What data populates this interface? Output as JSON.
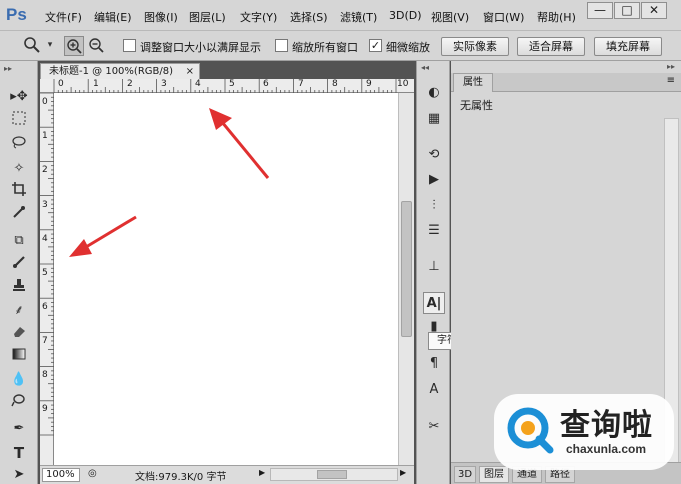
{
  "app": {
    "logo": "Ps",
    "menu": [
      "文件(F)",
      "编辑(E)",
      "图像(I)",
      "图层(L)",
      "文字(Y)",
      "选择(S)",
      "滤镜(T)",
      "3D(D)",
      "视图(V)",
      "窗口(W)",
      "帮助(H)"
    ],
    "window_controls": {
      "minimize": "—",
      "maximize": "□",
      "close": "✕"
    }
  },
  "options_bar": {
    "tool_icon": "zoom-icon",
    "checkboxes": [
      {
        "label": "调整窗口大小以满屏显示",
        "checked": false
      },
      {
        "label": "缩放所有窗口",
        "checked": false
      },
      {
        "label": "细微缩放",
        "checked": true
      }
    ],
    "buttons": [
      "实际像素",
      "适合屏幕",
      "填充屏幕"
    ]
  },
  "document": {
    "tab_title": "未标题-1 @ 100%(RGB/8)",
    "ruler_top_labels": [
      "0",
      "1",
      "2",
      "3",
      "4",
      "5",
      "6",
      "7",
      "8",
      "9",
      "10"
    ],
    "ruler_left_labels": [
      "0",
      "1",
      "2",
      "3",
      "4",
      "5",
      "6",
      "7",
      "8",
      "9"
    ],
    "status": {
      "zoom": "100%",
      "doc_info": "文档:979.3K/0 字节"
    }
  },
  "tooltip": "字符",
  "properties_panel": {
    "tab": "属性",
    "content": "无属性",
    "bottom_tabs": [
      "3D",
      "图层",
      "通道",
      "路径"
    ]
  },
  "watermark": {
    "title": "查询啦",
    "url": "chaxunla.com"
  },
  "colors": {
    "arrow": "#e03030",
    "watermark_blue": "#1c8fd6",
    "watermark_orange": "#f4a21c"
  }
}
